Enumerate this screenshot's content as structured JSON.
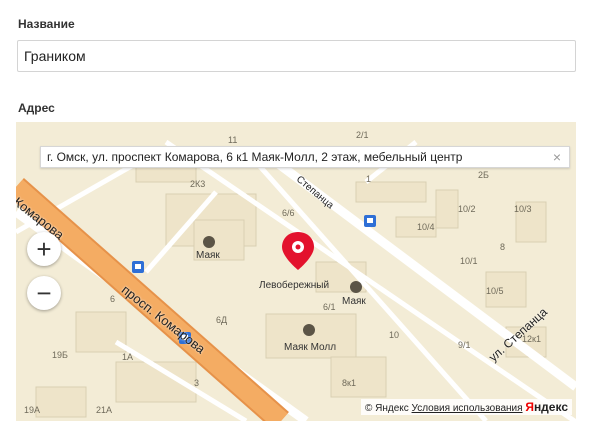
{
  "form": {
    "name_label": "Название",
    "name_value": "Граником",
    "address_label": "Адрес"
  },
  "map": {
    "search_value": "г. Омск, ул. проспект Комарова, 6 к1 Маяк-Молл, 2 этаж, мебельный центр",
    "clear_symbol": "×",
    "zoom_in": "+",
    "zoom_out": "−",
    "streets": {
      "komarova_left": "Комарова",
      "komarova_main": "просп. Комарова",
      "stepantsa_top": "Степанца",
      "stepantsa_bottom": "ул. Степанца"
    },
    "pois": {
      "mayak_1": "Маяк",
      "levoberezhny": "Левобережный",
      "mayak_2": "Маяк",
      "mayak_mall": "Маяк Молл"
    },
    "house_numbers": [
      "11",
      "2/1",
      "2",
      "2Б",
      "2К3",
      "6/6",
      "1",
      "10/2",
      "10/3",
      "10/4",
      "10/1",
      "10/5",
      "6/1",
      "10",
      "6Д",
      "9/1",
      "19Б",
      "1А",
      "3",
      "8к1",
      "12к1",
      "19А",
      "21А",
      "6",
      "8"
    ],
    "copyright": {
      "text": "© Яндекс",
      "terms": "Условия использования",
      "logo_ya": "Я",
      "logo_rest": "ндекс"
    }
  },
  "colors": {
    "map_background": "#f3ecd6",
    "main_road": "#f0a259",
    "marker": "#e3122d"
  },
  "icons": {
    "clear": "close-icon",
    "marker": "location-marker-icon",
    "shop": "shopping-cart-icon",
    "cinema": "cinema-icon",
    "bus_stop": "bus-stop-icon"
  }
}
